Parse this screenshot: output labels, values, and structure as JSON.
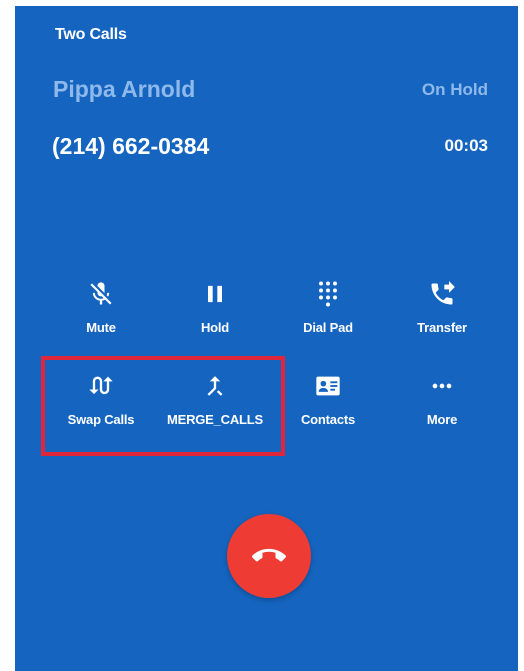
{
  "call": {
    "header": "Two Calls",
    "contact_name": "Pippa Arnold",
    "status": "On Hold",
    "phone_number": "(214) 662-0384",
    "duration": "00:03"
  },
  "actions_row1": [
    {
      "label": "Mute",
      "icon": "mic-off-icon"
    },
    {
      "label": "Hold",
      "icon": "pause-icon"
    },
    {
      "label": "Dial Pad",
      "icon": "dialpad-icon"
    },
    {
      "label": "Transfer",
      "icon": "phone-forward-icon"
    }
  ],
  "actions_row2": [
    {
      "label": "Swap Calls",
      "icon": "swap-calls-icon"
    },
    {
      "label": "MERGE_CALLS",
      "icon": "merge-icon"
    },
    {
      "label": "Contacts",
      "icon": "contact-card-icon"
    },
    {
      "label": "More",
      "icon": "more-horizontal-icon"
    }
  ],
  "hangup": {
    "icon": "call-end-icon"
  },
  "colors": {
    "background": "#1565c0",
    "secondary_text": "#8fb9ea",
    "hangup": "#ee3b33",
    "highlight_border": "#e0263a"
  }
}
